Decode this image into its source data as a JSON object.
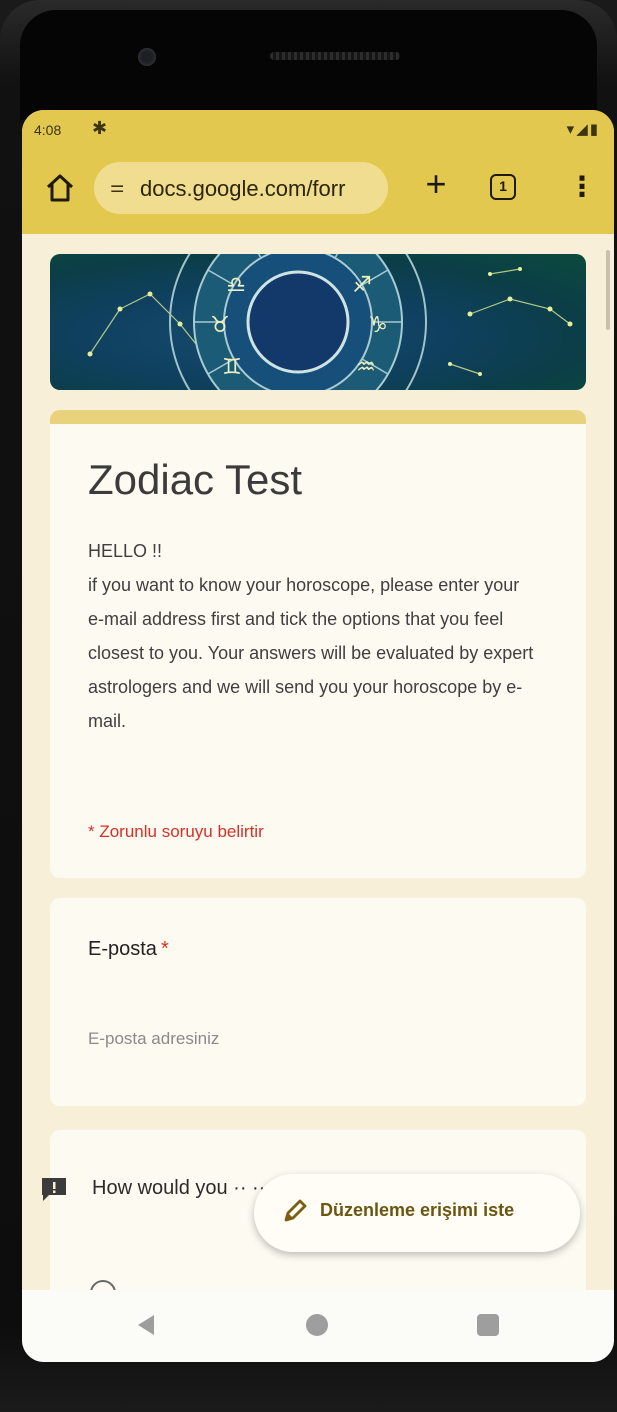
{
  "status_bar": {
    "time": "4:08",
    "icons": "▾◢▮"
  },
  "browser": {
    "url": "docs.google.com/forr",
    "tab_count": "1",
    "plus_label": "+",
    "menu_label": "⋮",
    "tune_icon": "⚌"
  },
  "form": {
    "title": "Zodiac Test",
    "description": "HELLO  !!\n if you want to know your horoscope, please enter your e-mail address first and tick the options that you feel closest to you. Your answers will be evaluated by expert astrologers and we will send you your horoscope by e-mail.",
    "required_note": "* Zorunlu soruyu belirtir",
    "email": {
      "label": "E-posta",
      "required_mark": "*",
      "placeholder": "E-posta adresiniz"
    },
    "question": {
      "text": "How would you ·· ··· disposition?"
    }
  },
  "fab": {
    "label": "Düzenleme erişimi iste"
  },
  "colors": {
    "toolbar": "#e3c84f",
    "page_bg": "#f7efd7",
    "accent_bar": "#e8d27b",
    "required_red": "#d93025"
  }
}
